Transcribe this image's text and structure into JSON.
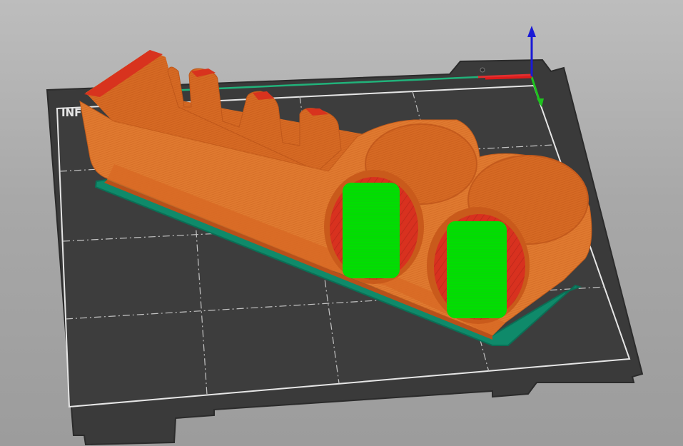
{
  "viewport": {
    "bed_label": "INFO"
  },
  "axes": {
    "x_color": "#e01b1b",
    "y_color": "#1ec31e",
    "z_color": "#1a1ad6"
  },
  "colors": {
    "background": "#a5a5a5",
    "bed_surface": "#3d3d3d",
    "bed_grid": "#bcbcbc",
    "bed_border": "#e6e6e6",
    "model_perimeter": "#d9681e",
    "model_infill": "#d9331e",
    "model_support": "#00e000",
    "skirt_brim": "#0f8a6a"
  },
  "icons": {
    "axes_gizmo": "xyz-axes-icon"
  }
}
